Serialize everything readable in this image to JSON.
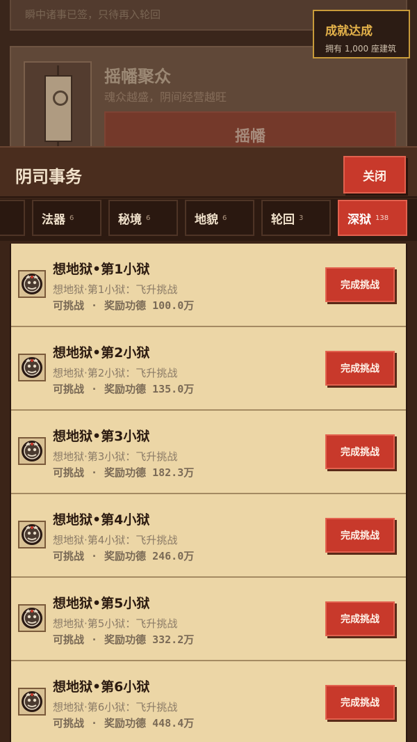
{
  "background": {
    "top_text": "瞬中诸事已签，只待再入轮回",
    "card_title": "摇幡聚众",
    "card_subtitle": "魂众越盛，阴间经营越旺",
    "card_button": "摇幡"
  },
  "achievement": {
    "title": "成就达成",
    "subtitle": "拥有 1,000 座建筑"
  },
  "panel": {
    "title": "阴司事务",
    "close_label": "关闭",
    "tabs": [
      {
        "label": "法器",
        "count": "6",
        "active": false
      },
      {
        "label": "秘境",
        "count": "6",
        "active": false
      },
      {
        "label": "地貌",
        "count": "6",
        "active": false
      },
      {
        "label": "轮回",
        "count": "3",
        "active": false
      },
      {
        "label": "深狱",
        "count": "138",
        "active": true
      }
    ]
  },
  "list": {
    "button_label": "完成挑战",
    "items": [
      {
        "title": "想地狱•第1小狱",
        "desc": "想地狱·第1小狱：飞升挑战",
        "status": "可挑战",
        "reward_label": "奖励功德",
        "reward": "100.0万",
        "icon": "demon-face-icon"
      },
      {
        "title": "想地狱•第2小狱",
        "desc": "想地狱·第2小狱：飞升挑战",
        "status": "可挑战",
        "reward_label": "奖励功德",
        "reward": "135.0万",
        "icon": "demon-face-icon"
      },
      {
        "title": "想地狱•第3小狱",
        "desc": "想地狱·第3小狱：飞升挑战",
        "status": "可挑战",
        "reward_label": "奖励功德",
        "reward": "182.3万",
        "icon": "demon-face-icon"
      },
      {
        "title": "想地狱•第4小狱",
        "desc": "想地狱·第4小狱：飞升挑战",
        "status": "可挑战",
        "reward_label": "奖励功德",
        "reward": "246.0万",
        "icon": "demon-face-icon"
      },
      {
        "title": "想地狱•第5小狱",
        "desc": "想地狱·第5小狱：飞升挑战",
        "status": "可挑战",
        "reward_label": "奖励功德",
        "reward": "332.2万",
        "icon": "demon-face-icon"
      },
      {
        "title": "想地狱•第6小狱",
        "desc": "想地狱·第6小狱：飞升挑战",
        "status": "可挑战",
        "reward_label": "奖励功德",
        "reward": "448.4万",
        "icon": "demon-face-icon"
      }
    ]
  },
  "colors": {
    "accent": "#c8392b",
    "gold": "#e4b24a",
    "row_bg": "#ecd6a6"
  }
}
